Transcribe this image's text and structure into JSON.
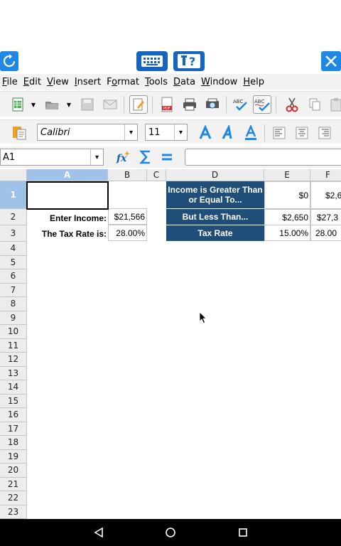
{
  "menu": [
    "File",
    "Edit",
    "View",
    "Insert",
    "Format",
    "Tools",
    "Data",
    "Window",
    "Help"
  ],
  "menu_mnemonics": [
    "F",
    "E",
    "V",
    "I",
    "o",
    "T",
    "D",
    "W",
    "H"
  ],
  "font": {
    "name": "Calibri",
    "size": "11"
  },
  "name_box": "A1",
  "columns": [
    "A",
    "B",
    "C",
    "D",
    "E",
    "F"
  ],
  "rows": [
    "1",
    "2",
    "3",
    "4",
    "5",
    "6",
    "7",
    "8",
    "9",
    "10",
    "11",
    "12",
    "13",
    "14",
    "15",
    "16",
    "17",
    "18",
    "19",
    "20",
    "21",
    "22",
    "23"
  ],
  "cells": {
    "A2": "Enter Income:",
    "A3": "The Tax Rate is:",
    "B2": "$21,566",
    "B3": "28.00%",
    "D1": "Income is Greater Than or Equal To...",
    "D2": "But Less Than...",
    "D3": "Tax Rate",
    "E1": "$0",
    "E2": "$2,650",
    "E3": "15.00%",
    "F1": "$2,6",
    "F2": "$27,3",
    "F3": "28.00"
  },
  "colors": {
    "header_dark": "#1f4e79",
    "selection": "#9fc3e8",
    "remote_blue": "#1e88e5"
  }
}
